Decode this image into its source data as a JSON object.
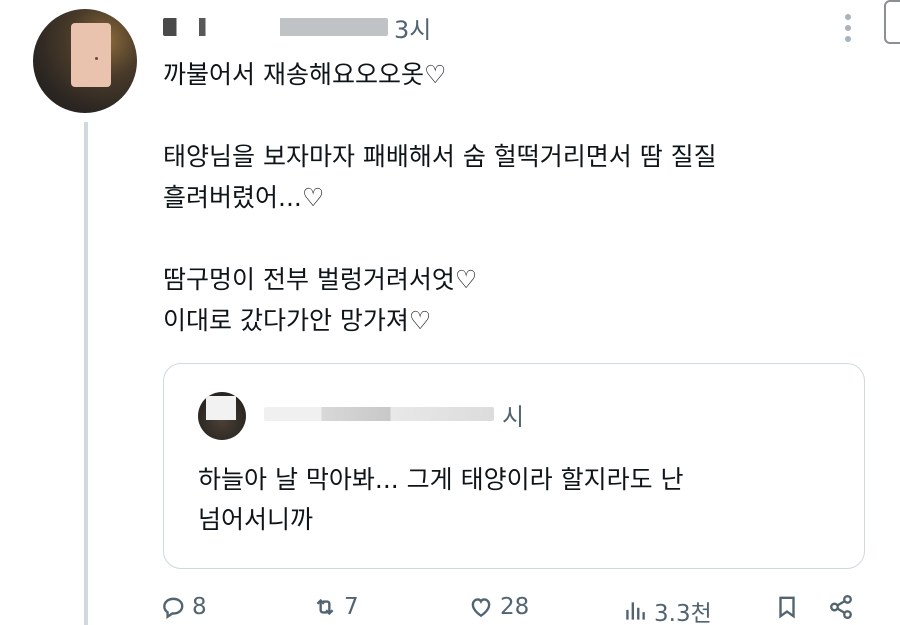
{
  "tweet": {
    "time": "3시",
    "lines": [
      "까불어서 재송해요오오옷♡",
      "",
      "태양님을 보자마자 패배해서 숨 헐떡거리면서 땀 질질",
      "흘려버렸어...♡",
      "",
      "땀구멍이 전부 벌렁거려서엇♡",
      "이대로 갔다가안 망가져♡"
    ]
  },
  "quoted": {
    "time": "시",
    "lines": [
      "하늘아 날 막아봐... 그게 태양이라 할지라도 난",
      "넘어서니까"
    ]
  },
  "actions": {
    "replies": "8",
    "reposts": "7",
    "likes": "28",
    "views": "3.3천"
  },
  "icons": {
    "more": "more-vertical-icon",
    "reply": "reply-icon",
    "repost": "repost-icon",
    "like": "heart-icon",
    "views": "views-icon",
    "bookmark": "bookmark-icon",
    "share": "share-icon"
  },
  "colors": {
    "text": "#0f1419",
    "secondary": "#536471",
    "border": "#cfd9de"
  }
}
